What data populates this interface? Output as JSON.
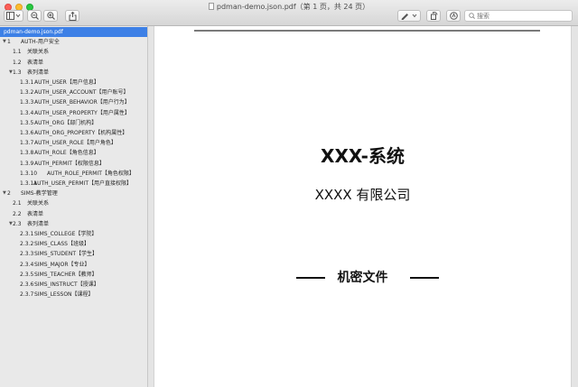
{
  "window": {
    "title": "pdman-demo.json.pdf（第 1 页，共 24 页）"
  },
  "toolbar": {
    "search_placeholder": "搜索",
    "icons": [
      "sidebar-toggle-icon",
      "chevron-down-icon",
      "zoom-out-icon",
      "zoom-in-icon",
      "share-icon",
      "markup-pen-icon",
      "chevron-down-icon",
      "rotate-icon",
      "annotate-circle-icon",
      "search-icon"
    ]
  },
  "sidebar": {
    "items": [
      {
        "level": 0,
        "num": "",
        "label": "pdman-demo.json.pdf",
        "selected": true,
        "expand": ""
      },
      {
        "level": 0,
        "num": "1",
        "label": "AUTH-用户安全",
        "expand": "▼"
      },
      {
        "level": 1,
        "num": "1.1",
        "label": "关联关系",
        "expand": ""
      },
      {
        "level": 1,
        "num": "1.2",
        "label": "表清单",
        "expand": ""
      },
      {
        "level": 1,
        "num": "1.3",
        "label": "表列清单",
        "expand": "▼"
      },
      {
        "level": 2,
        "num": "1.3.1",
        "label": "AUTH_USER【用户信息】",
        "expand": ""
      },
      {
        "level": 2,
        "num": "1.3.2",
        "label": "AUTH_USER_ACCOUNT【用户账号】",
        "expand": ""
      },
      {
        "level": 2,
        "num": "1.3.3",
        "label": "AUTH_USER_BEHAVIOR【用户行为】",
        "expand": ""
      },
      {
        "level": 2,
        "num": "1.3.4",
        "label": "AUTH_USER_PROPERTY【用户属性】",
        "expand": ""
      },
      {
        "level": 2,
        "num": "1.3.5",
        "label": "AUTH_ORG【部门机构】",
        "expand": ""
      },
      {
        "level": 2,
        "num": "1.3.6",
        "label": "AUTH_ORG_PROPERTY【机构属性】",
        "expand": ""
      },
      {
        "level": 2,
        "num": "1.3.7",
        "label": "AUTH_USER_ROLE【用户角色】",
        "expand": ""
      },
      {
        "level": 2,
        "num": "1.3.8",
        "label": "AUTH_ROLE【角色信息】",
        "expand": ""
      },
      {
        "level": 2,
        "num": "1.3.9",
        "label": "AUTH_PERMIT【权限信息】",
        "expand": ""
      },
      {
        "level": 2,
        "num": "1.3.10",
        "label": "AUTH_ROLE_PERMIT【角色权限】",
        "expand": ""
      },
      {
        "level": 2,
        "num": "1.3.11",
        "label": "AUTH_USER_PERMIT【用户直接权限】",
        "expand": ""
      },
      {
        "level": 0,
        "num": "2",
        "label": "SIMS-教学管理",
        "expand": "▼"
      },
      {
        "level": 1,
        "num": "2.1",
        "label": "关联关系",
        "expand": ""
      },
      {
        "level": 1,
        "num": "2.2",
        "label": "表清单",
        "expand": ""
      },
      {
        "level": 1,
        "num": "2.3",
        "label": "表列清单",
        "expand": "▼"
      },
      {
        "level": 2,
        "num": "2.3.1",
        "label": "SIMS_COLLEGE【学院】",
        "expand": ""
      },
      {
        "level": 2,
        "num": "2.3.2",
        "label": "SIMS_CLASS【班级】",
        "expand": ""
      },
      {
        "level": 2,
        "num": "2.3.3",
        "label": "SIMS_STUDENT【学生】",
        "expand": ""
      },
      {
        "level": 2,
        "num": "2.3.4",
        "label": "SIMS_MAJOR【专业】",
        "expand": ""
      },
      {
        "level": 2,
        "num": "2.3.5",
        "label": "SIMS_TEACHER【教师】",
        "expand": ""
      },
      {
        "level": 2,
        "num": "2.3.6",
        "label": "SIMS_INSTRUCT【授课】",
        "expand": ""
      },
      {
        "level": 2,
        "num": "2.3.7",
        "label": "SIMS_LESSON【课程】",
        "expand": ""
      }
    ]
  },
  "document": {
    "title": "XXX-系统",
    "company": "XXXX 有限公司",
    "confidential": "机密文件"
  },
  "colors": {
    "selection": "#3d80e6",
    "close": "#fc5f57",
    "minimize": "#fdbc2e",
    "maximize": "#28c840"
  }
}
